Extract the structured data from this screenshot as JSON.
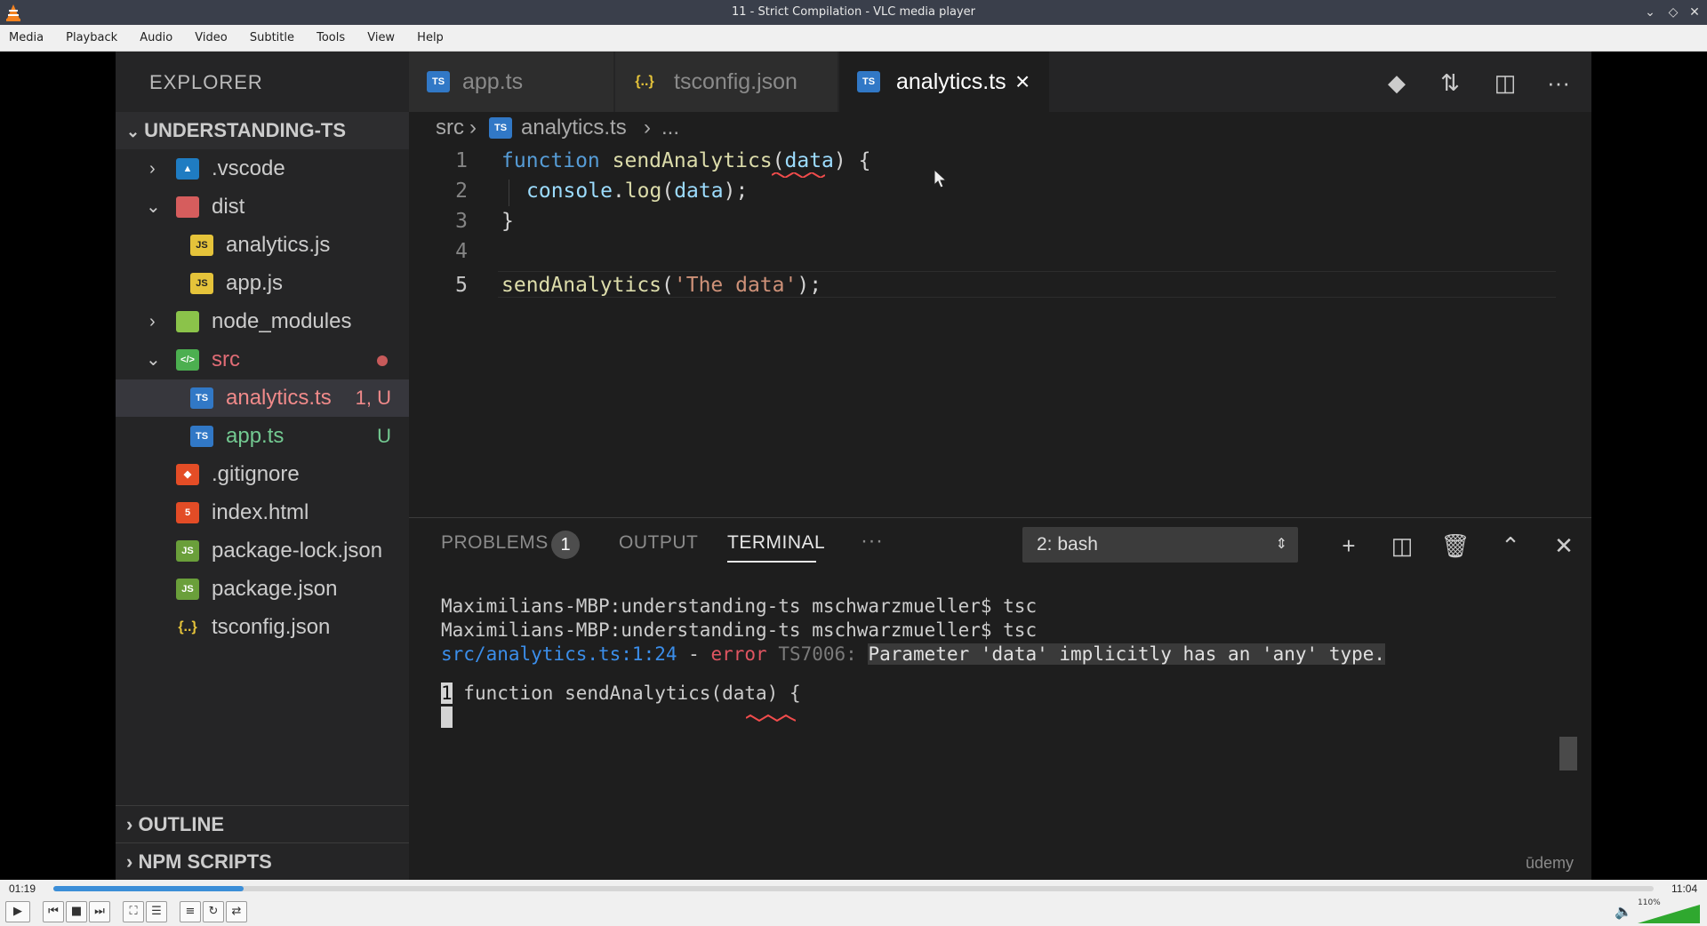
{
  "window": {
    "title": "11 - Strict Compilation - VLC media player"
  },
  "menubar": [
    "Media",
    "Playback",
    "Audio",
    "Video",
    "Subtitle",
    "Tools",
    "View",
    "Help"
  ],
  "explorer": {
    "title": "EXPLORER",
    "root": "UNDERSTANDING-TS",
    "items": [
      {
        "label": ".vscode",
        "badge": ""
      },
      {
        "label": "dist",
        "badge": ""
      },
      {
        "label": "analytics.js",
        "badge": ""
      },
      {
        "label": "app.js",
        "badge": ""
      },
      {
        "label": "node_modules",
        "badge": ""
      },
      {
        "label": "src",
        "badge": ""
      },
      {
        "label": "analytics.ts",
        "badge": "1, U"
      },
      {
        "label": "app.ts",
        "badge": "U"
      },
      {
        "label": ".gitignore",
        "badge": ""
      },
      {
        "label": "index.html",
        "badge": ""
      },
      {
        "label": "package-lock.json",
        "badge": ""
      },
      {
        "label": "package.json",
        "badge": ""
      },
      {
        "label": "tsconfig.json",
        "badge": ""
      }
    ],
    "outline": "OUTLINE",
    "npm_scripts": "NPM SCRIPTS"
  },
  "tabs": [
    {
      "label": "app.ts"
    },
    {
      "label": "tsconfig.json"
    },
    {
      "label": "analytics.ts"
    }
  ],
  "breadcrumb": {
    "folder": "src",
    "file": "analytics.ts",
    "more": "..."
  },
  "editor": {
    "line_numbers": [
      "1",
      "2",
      "3",
      "4",
      "5"
    ]
  },
  "panel": {
    "tabs": {
      "problems": "PROBLEMS",
      "problems_count": "1",
      "output": "OUTPUT",
      "terminal": "TERMINAL",
      "more": "···"
    },
    "terminal_select": "2: bash",
    "terminal": {
      "line1": "Maximilians-MBP:understanding-ts mschwarzmueller$ tsc",
      "line2": "Maximilians-MBP:understanding-ts mschwarzmueller$ tsc",
      "err_path": "src/analytics.ts:1:24",
      "err_sep": " - ",
      "err_word": "error",
      "err_code": " TS7006: ",
      "err_msg": "Parameter 'data' implicitly has an 'any' type.",
      "src_num": "1",
      "src_line": " function sendAnalytics(data) {"
    },
    "watermark": "ūdemy"
  },
  "player": {
    "elapsed": "01:19",
    "total": "11:04",
    "progress": 0.119,
    "volume_label": "110%",
    "volume_level": 1.0,
    "accent_color": "#3b8ed8"
  }
}
